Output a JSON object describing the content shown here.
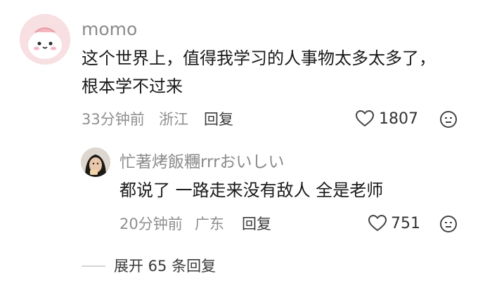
{
  "comment": {
    "username": "momo",
    "text_line1": "这个世界上，值得我学习的人事物太多太多了，",
    "text_line2": "根本学不过来",
    "time": "33分钟前",
    "location": "浙江",
    "reply_label": "回复",
    "like_count": "1807",
    "like_icon": "heart-outline-icon",
    "dislike_icon": "sad-face-icon"
  },
  "reply": {
    "username": "忙著烤飯糰rrrおいしい",
    "text": "都说了 一路走来没有敌人 全是老师",
    "time": "20分钟前",
    "location": "广东",
    "reply_label": "回复",
    "like_count": "751",
    "like_icon": "heart-outline-icon",
    "dislike_icon": "sad-face-icon"
  },
  "expand": {
    "label": "展开 65 条回复"
  },
  "colors": {
    "username": "#8a8a8a",
    "meta": "#8e8e8e",
    "text": "#1a1a1a",
    "avatar_bg": "#f6d9dd"
  }
}
